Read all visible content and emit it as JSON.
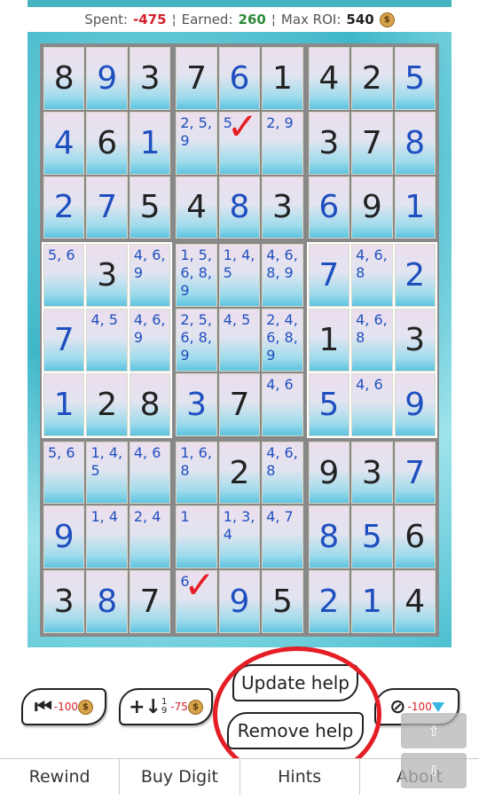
{
  "stats": {
    "spent_label": "Spent:",
    "spent_value": "-475",
    "earned_label": "Earned:",
    "earned_value": "260",
    "max_label": "Max ROI:",
    "max_value": "540",
    "sep": "¦"
  },
  "colors": {
    "accent": "#47b3bf",
    "candidate": "#1f4fbf",
    "given": "#222222",
    "mark": "#e51e25"
  },
  "board": {
    "boxes": [
      {
        "light": false,
        "cells": [
          {
            "t": "given",
            "v": "8"
          },
          {
            "t": "solved",
            "v": "9"
          },
          {
            "t": "given",
            "v": "3"
          },
          {
            "t": "solved",
            "v": "4"
          },
          {
            "t": "given",
            "v": "6"
          },
          {
            "t": "solved",
            "v": "1"
          },
          {
            "t": "solved",
            "v": "2"
          },
          {
            "t": "solved",
            "v": "7"
          },
          {
            "t": "given",
            "v": "5"
          }
        ]
      },
      {
        "light": false,
        "cells": [
          {
            "t": "given",
            "v": "7"
          },
          {
            "t": "solved",
            "v": "6"
          },
          {
            "t": "given",
            "v": "1"
          },
          {
            "t": "cand",
            "v": "2, 5, 9"
          },
          {
            "t": "cand",
            "v": "5",
            "check": true
          },
          {
            "t": "cand",
            "v": "2, 9"
          },
          {
            "t": "given",
            "v": "4"
          },
          {
            "t": "solved",
            "v": "8"
          },
          {
            "t": "given",
            "v": "3"
          }
        ]
      },
      {
        "light": false,
        "cells": [
          {
            "t": "given",
            "v": "4"
          },
          {
            "t": "given",
            "v": "2"
          },
          {
            "t": "solved",
            "v": "5"
          },
          {
            "t": "given",
            "v": "3"
          },
          {
            "t": "given",
            "v": "7"
          },
          {
            "t": "solved",
            "v": "8"
          },
          {
            "t": "solved",
            "v": "6"
          },
          {
            "t": "given",
            "v": "9"
          },
          {
            "t": "solved",
            "v": "1"
          }
        ]
      },
      {
        "light": true,
        "cells": [
          {
            "t": "cand",
            "v": "5, 6"
          },
          {
            "t": "given",
            "v": "3"
          },
          {
            "t": "cand",
            "v": "4, 6, 9"
          },
          {
            "t": "solved",
            "v": "7"
          },
          {
            "t": "cand",
            "v": "4, 5"
          },
          {
            "t": "cand",
            "v": "4, 6, 9"
          },
          {
            "t": "solved",
            "v": "1"
          },
          {
            "t": "given",
            "v": "2"
          },
          {
            "t": "given",
            "v": "8"
          }
        ]
      },
      {
        "light": false,
        "cells": [
          {
            "t": "cand",
            "v": "1, 5, 6, 8, 9"
          },
          {
            "t": "cand",
            "v": "1, 4, 5"
          },
          {
            "t": "cand",
            "v": "4, 6, 8, 9"
          },
          {
            "t": "cand",
            "v": "2, 5, 6, 8, 9"
          },
          {
            "t": "cand",
            "v": "4, 5"
          },
          {
            "t": "cand",
            "v": "2, 4, 6, 8, 9"
          },
          {
            "t": "solved",
            "v": "3"
          },
          {
            "t": "given",
            "v": "7"
          },
          {
            "t": "cand",
            "v": "4, 6"
          }
        ]
      },
      {
        "light": true,
        "cells": [
          {
            "t": "solved",
            "v": "7"
          },
          {
            "t": "cand",
            "v": "4, 6, 8"
          },
          {
            "t": "solved",
            "v": "2"
          },
          {
            "t": "given",
            "v": "1"
          },
          {
            "t": "cand",
            "v": "4, 6, 8"
          },
          {
            "t": "given",
            "v": "3"
          },
          {
            "t": "solved",
            "v": "5"
          },
          {
            "t": "cand",
            "v": "4, 6"
          },
          {
            "t": "solved",
            "v": "9"
          }
        ]
      },
      {
        "light": false,
        "cells": [
          {
            "t": "cand",
            "v": "5, 6"
          },
          {
            "t": "cand",
            "v": "1, 4, 5"
          },
          {
            "t": "cand",
            "v": "4, 6"
          },
          {
            "t": "solved",
            "v": "9"
          },
          {
            "t": "cand",
            "v": "1, 4"
          },
          {
            "t": "cand",
            "v": "2, 4"
          },
          {
            "t": "given",
            "v": "3"
          },
          {
            "t": "solved",
            "v": "8"
          },
          {
            "t": "given",
            "v": "7"
          }
        ]
      },
      {
        "light": false,
        "cells": [
          {
            "t": "cand",
            "v": "1, 6, 8"
          },
          {
            "t": "given",
            "v": "2"
          },
          {
            "t": "cand",
            "v": "4, 6, 8"
          },
          {
            "t": "cand",
            "v": "1"
          },
          {
            "t": "cand",
            "v": "1, 3, 4"
          },
          {
            "t": "cand",
            "v": "4, 7"
          },
          {
            "t": "cand",
            "v": "6",
            "check": true
          },
          {
            "t": "solved",
            "v": "9"
          },
          {
            "t": "given",
            "v": "5"
          }
        ]
      },
      {
        "light": false,
        "cells": [
          {
            "t": "given",
            "v": "9"
          },
          {
            "t": "given",
            "v": "3"
          },
          {
            "t": "solved",
            "v": "7"
          },
          {
            "t": "solved",
            "v": "8"
          },
          {
            "t": "solved",
            "v": "5"
          },
          {
            "t": "given",
            "v": "6"
          },
          {
            "t": "solved",
            "v": "2"
          },
          {
            "t": "solved",
            "v": "1"
          },
          {
            "t": "given",
            "v": "4"
          }
        ]
      }
    ]
  },
  "actions": {
    "rewind_icon": "⏮",
    "rewind_cost": "-100",
    "buy_icon": "+↓",
    "buy_sub_top": "1",
    "buy_sub_bottom": "9",
    "buy_cost": "-75",
    "abort_icon": "⊘",
    "abort_cost": "-100"
  },
  "help": {
    "update_label": "Update help",
    "remove_label": "Remove help"
  },
  "tabs": [
    "Rewind",
    "Buy Digit",
    "Hints",
    "Abort"
  ],
  "check_glyph": "✓",
  "coin_glyph": "$",
  "scroll_up_glyph": "⇧",
  "scroll_down_glyph": "⇩"
}
